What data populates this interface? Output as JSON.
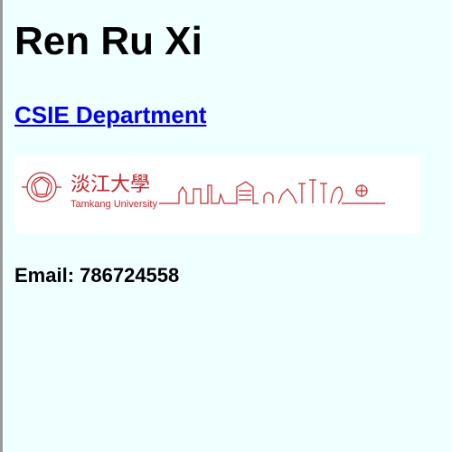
{
  "profile": {
    "name": "Ren Ru Xi",
    "department_link": "CSIE Department",
    "email_label": "Email: ",
    "email_value": "786724558"
  },
  "logo": {
    "chinese_name": "淡江大學",
    "english_name": "Tamkang University",
    "color": "#c0262d"
  },
  "colors": {
    "background": "#f0ffff",
    "link": "#0000ee",
    "logo_red": "#c0262d"
  }
}
